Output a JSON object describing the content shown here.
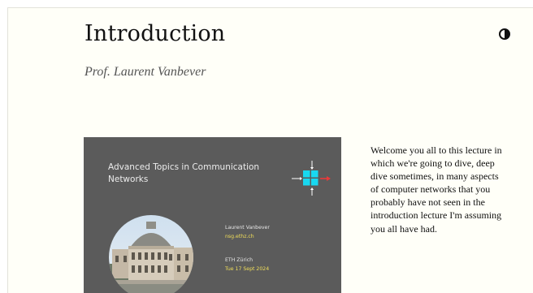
{
  "header": {
    "title": "Introduction",
    "subtitle": "Prof. Laurent Vanbever",
    "theme_toggle_icon": "half-circle-contrast-icon"
  },
  "slide": {
    "course_title": "Advanced Topics in Communication Networks",
    "presenter": "Laurent Vanbever",
    "website": "nsg.ethz.ch",
    "institution": "ETH Zürich",
    "date": "Tue 17 Sept 2024",
    "logo_icon": "network-node-icon",
    "photo": "eth-main-building-photo",
    "colors": {
      "background": "#5b5b5b",
      "accent_text": "#f2df5a",
      "logo_square": "#18d8f0",
      "logo_arrow": "#e83a3a"
    }
  },
  "transcript": {
    "text": "Welcome you all to this lecture in which we're going to dive, deep dive sometimes, in many aspects of computer networks that you probably have not seen in the introduction lecture I'm assuming you all have had."
  }
}
